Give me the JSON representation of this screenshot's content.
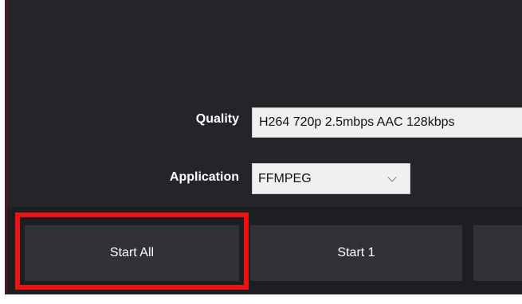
{
  "form": {
    "quality_label": "Quality",
    "quality_value": "H264 720p 2.5mbps AAC 128kbps",
    "application_label": "Application",
    "application_value": "FFMPEG"
  },
  "buttons": {
    "start_all": "Start All",
    "start_1": "Start 1",
    "partial": ""
  },
  "icons": {
    "dropdown": "chevron-down-icon"
  },
  "colors": {
    "panel": "#232529",
    "button": "#303237",
    "highlight": "#ee1111",
    "select_background": "#f0f0f0"
  }
}
